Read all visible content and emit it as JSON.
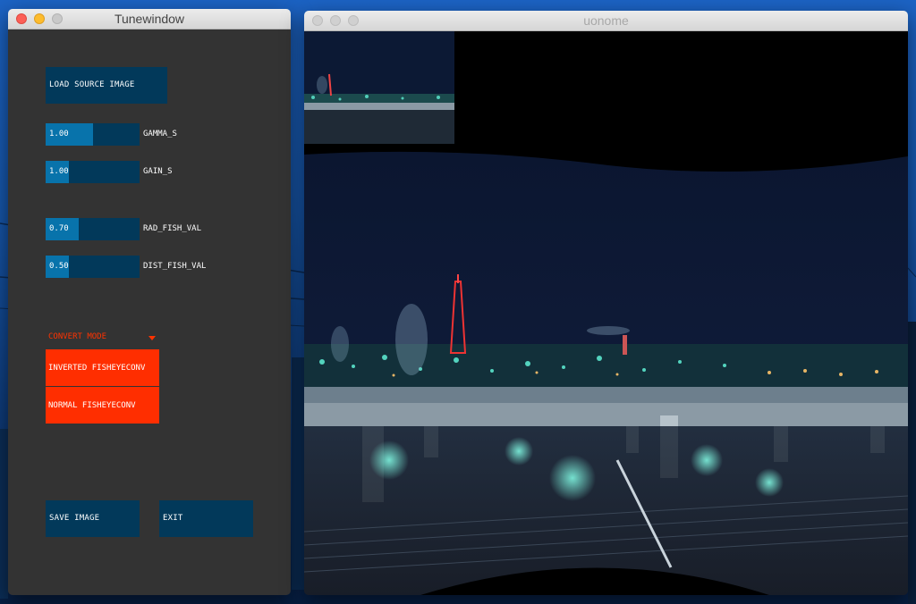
{
  "tunewindow": {
    "title": "Tunewindow",
    "load_button": "LOAD SOURCE IMAGE",
    "sliders": [
      {
        "name": "GAMMA_S",
        "value": "1.00",
        "fill": 0.5
      },
      {
        "name": "GAIN_S",
        "value": "1.00",
        "fill": 0.25
      },
      {
        "name": "RAD_FISH_VAL",
        "value": "0.70",
        "fill": 0.35
      },
      {
        "name": "DIST_FISH_VAL",
        "value": "0.50",
        "fill": 0.25
      }
    ],
    "convert_mode": {
      "label": "CONVERT MODE",
      "options": [
        "INVERTED FISHEYECONV",
        "NORMAL FISHEYECONV"
      ]
    },
    "save_button": "SAVE IMAGE",
    "exit_button": "EXIT"
  },
  "image_window": {
    "title": "uonome"
  },
  "colors": {
    "panel_bg": "#333333",
    "control_bg": "#02395a",
    "control_fill": "#0873ab",
    "accent": "#ff2e00"
  }
}
